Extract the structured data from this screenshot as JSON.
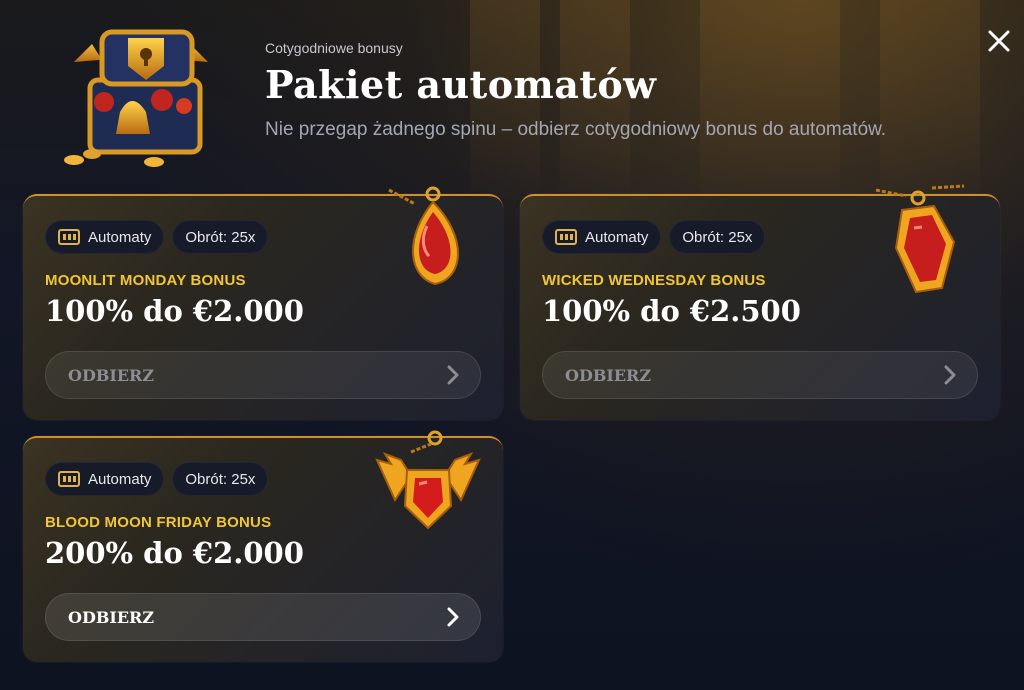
{
  "header": {
    "eyebrow": "Cotygodniowe bonusy",
    "title": "Pakiet automatów",
    "subtitle": "Nie przegap żadnego spinu – odbierz cotygodniowy bonus do automatów."
  },
  "cards": [
    {
      "category_label": "Automaty",
      "wager_label": "Obrót: 25x",
      "name": "MOONLIT MONDAY BONUS",
      "amount": "100% do €2.000",
      "button_label": "ODBIERZ",
      "button_enabled": false,
      "icon": "red-drop-amulet-icon"
    },
    {
      "category_label": "Automaty",
      "wager_label": "Obrót: 25x",
      "name": "WICKED WEDNESDAY BONUS",
      "amount": "100% do €2.500",
      "button_label": "ODBIERZ",
      "button_enabled": false,
      "icon": "red-coffin-amulet-icon"
    },
    {
      "category_label": "Automaty",
      "wager_label": "Obrót: 25x",
      "name": "BLOOD MOON FRIDAY BONUS",
      "amount": "200% do €2.000",
      "button_label": "ODBIERZ",
      "button_enabled": true,
      "icon": "winged-gem-amulet-icon"
    }
  ],
  "colors": {
    "accent_gold": "#f2c534",
    "card_border": "#d08f2a",
    "background": "#0f1422"
  }
}
